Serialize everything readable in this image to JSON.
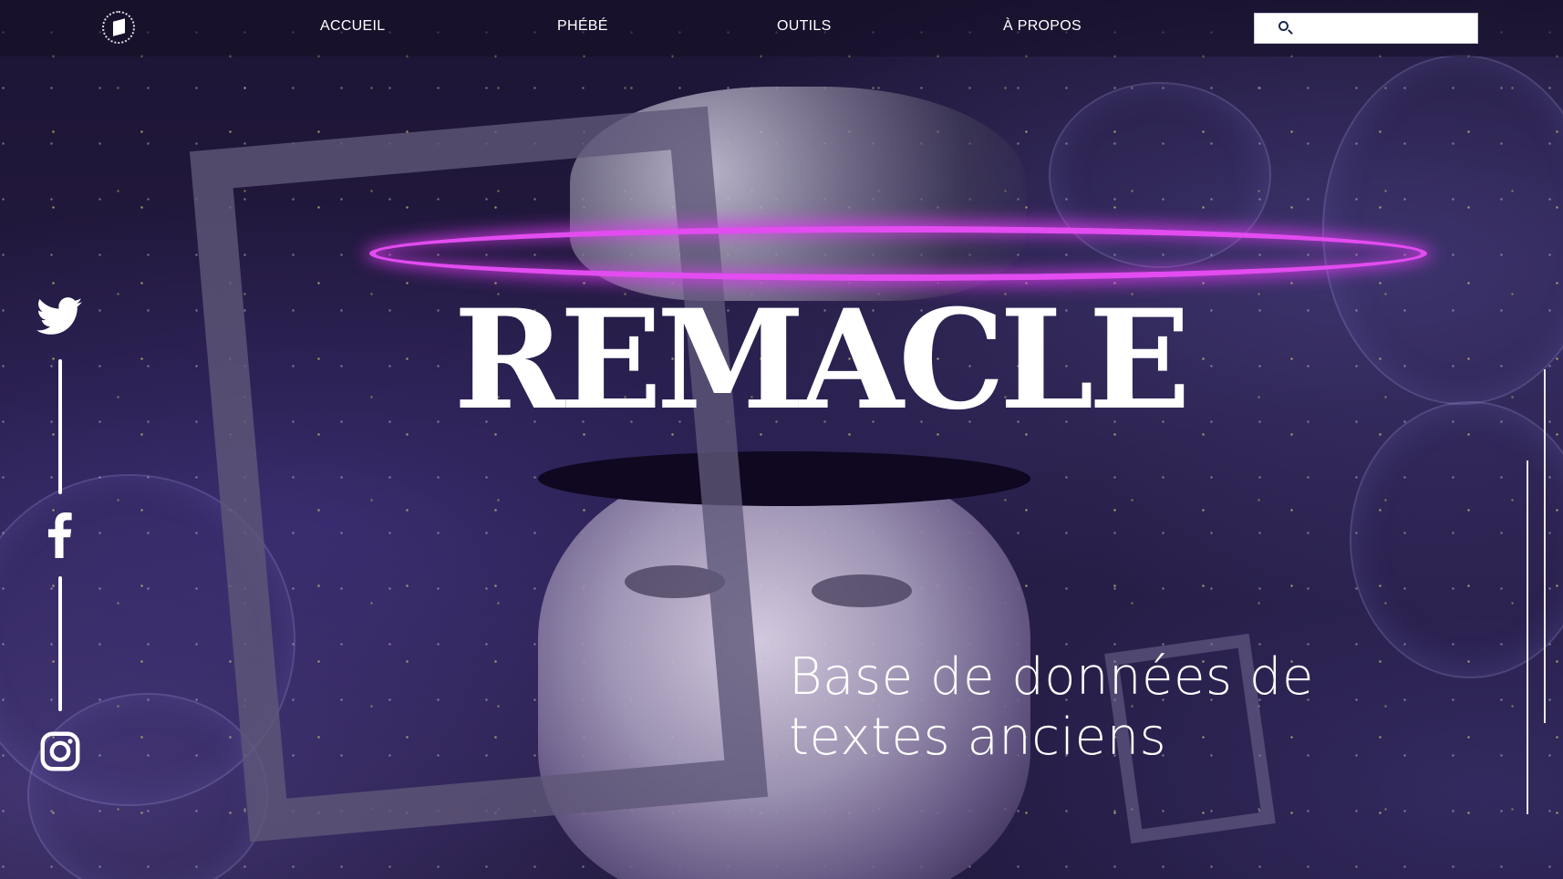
{
  "nav": {
    "items": [
      {
        "label": "ACCUEIL"
      },
      {
        "label": "PHÉBÉ"
      },
      {
        "label": "OUTILS"
      },
      {
        "label": "À PROPOS"
      }
    ],
    "search": {
      "placeholder": "",
      "value": "",
      "icon": "search-icon"
    }
  },
  "hero": {
    "title": "REMACLE",
    "subtitle_line1": "Base de données de",
    "subtitle_line2": "textes anciens"
  },
  "social": {
    "icons": [
      "twitter-icon",
      "facebook-icon",
      "instagram-icon"
    ]
  },
  "colors": {
    "background": "#1d1535",
    "halo": "#e24cf0",
    "text": "#ffffff"
  }
}
